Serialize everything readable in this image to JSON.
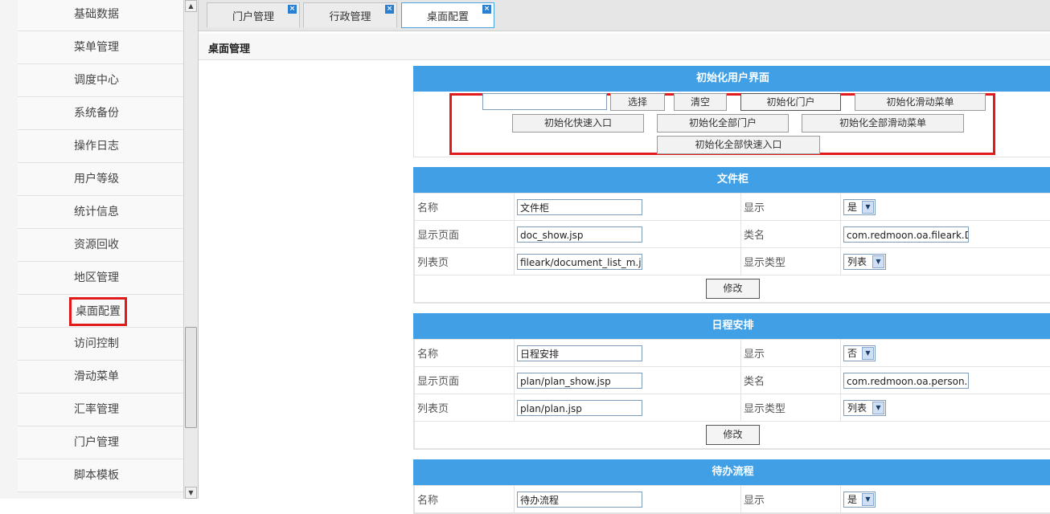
{
  "sidebar": {
    "items": [
      {
        "label": "基础数据",
        "active": false
      },
      {
        "label": "菜单管理",
        "active": false
      },
      {
        "label": "调度中心",
        "active": false
      },
      {
        "label": "系统备份",
        "active": false
      },
      {
        "label": "操作日志",
        "active": false
      },
      {
        "label": "用户等级",
        "active": false
      },
      {
        "label": "统计信息",
        "active": false
      },
      {
        "label": "资源回收",
        "active": false
      },
      {
        "label": "地区管理",
        "active": false
      },
      {
        "label": "桌面配置",
        "active": true
      },
      {
        "label": "访问控制",
        "active": false
      },
      {
        "label": "滑动菜单",
        "active": false
      },
      {
        "label": "汇率管理",
        "active": false
      },
      {
        "label": "门户管理",
        "active": false
      },
      {
        "label": "脚本模板",
        "active": false
      }
    ]
  },
  "tabs": [
    {
      "label": "门户管理",
      "active": false
    },
    {
      "label": "行政管理",
      "active": false
    },
    {
      "label": "桌面配置",
      "active": true
    }
  ],
  "header": {
    "title": "桌面管理"
  },
  "init_panel": {
    "title": "初始化用户界面",
    "input_value": "",
    "buttons": {
      "select": "选择",
      "clear": "清空",
      "init_portal": "初始化门户",
      "init_slide_menu": "初始化滑动菜单",
      "init_quick_entry": "初始化快速入口",
      "init_all_portal": "初始化全部门户",
      "init_all_slide_menu": "初始化全部滑动菜单",
      "init_all_quick_entry": "初始化全部快速入口"
    }
  },
  "labels": {
    "name": "名称",
    "display_page": "显示页面",
    "list_page": "列表页",
    "display": "显示",
    "class_name": "类名",
    "display_type": "显示类型",
    "modify": "修改"
  },
  "modules": [
    {
      "title": "文件柜",
      "name": "文件柜",
      "display_page": "doc_show.jsp",
      "list_page": "fileark/document_list_m.js",
      "display": "是",
      "class_name": "com.redmoon.oa.fileark.Do",
      "display_type": "列表"
    },
    {
      "title": "日程安排",
      "name": "日程安排",
      "display_page": "plan/plan_show.jsp",
      "list_page": "plan/plan.jsp",
      "display": "否",
      "class_name": "com.redmoon.oa.person.P",
      "display_type": "列表"
    },
    {
      "title": "待办流程",
      "name": "待办流程",
      "display": "是"
    }
  ],
  "colors": {
    "panel_header": "#41a0e5",
    "highlight": "#e11b1b",
    "active_tab_border": "#4aa3df"
  }
}
